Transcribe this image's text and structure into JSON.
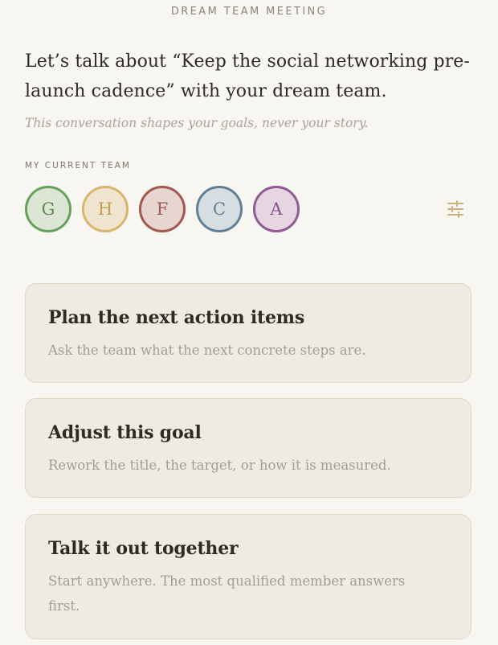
{
  "header": {
    "title": "DREAM TEAM MEETING"
  },
  "intro": {
    "text": "Let’s talk about “Keep the social networking pre-launch cadence” with your dream team.",
    "subtitle": "This conversation shapes your goals, never your story."
  },
  "team": {
    "label": "MY CURRENT TEAM",
    "members": [
      {
        "initial": "G",
        "ring_color": "#66a05a",
        "fill_color": "#dde6d4",
        "text_color": "#5d8a52"
      },
      {
        "initial": "H",
        "ring_color": "#d9b46a",
        "fill_color": "#efe5cf",
        "text_color": "#c29d52"
      },
      {
        "initial": "F",
        "ring_color": "#a2574f",
        "fill_color": "#e7d5cf",
        "text_color": "#9a5a50"
      },
      {
        "initial": "C",
        "ring_color": "#627f95",
        "fill_color": "#d7dee2",
        "text_color": "#637d8e"
      },
      {
        "initial": "A",
        "ring_color": "#925a92",
        "fill_color": "#e5d6e1",
        "text_color": "#875587"
      }
    ],
    "filter_icon": "sliders-icon",
    "filter_icon_color": "#c9b27f"
  },
  "actions": [
    {
      "title": "Plan the next action items",
      "description": "Ask the team what the next concrete steps are."
    },
    {
      "title": "Adjust this goal",
      "description": "Rework the title, the target, or how it is measured."
    },
    {
      "title": "Talk it out together",
      "description": "Start anywhere. The most qualified member answers first."
    }
  ]
}
